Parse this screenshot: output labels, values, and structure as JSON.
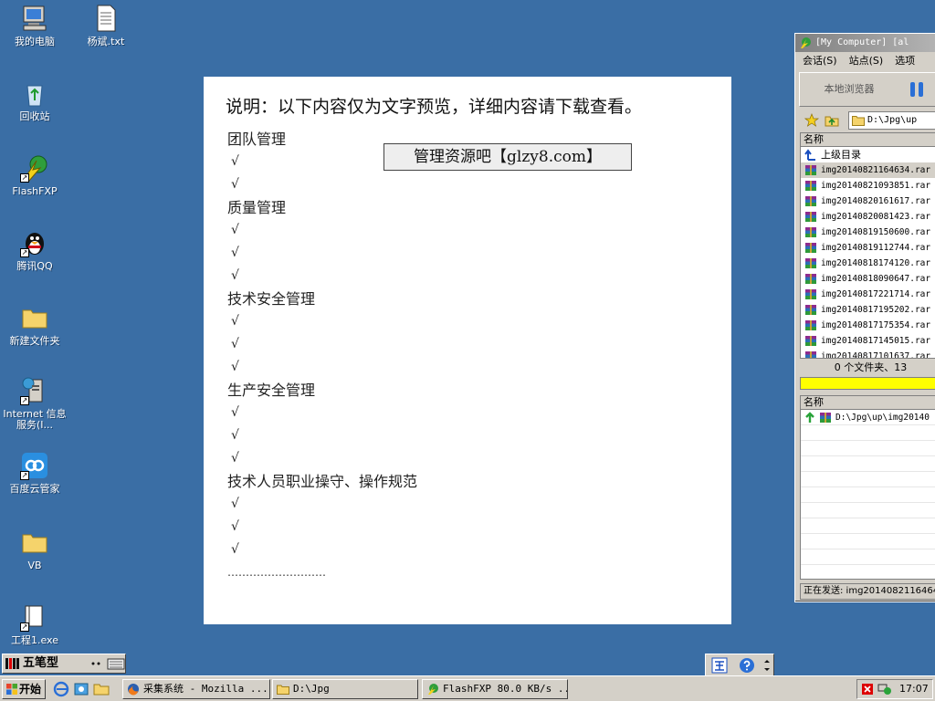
{
  "desktop": {
    "icons": [
      {
        "label": "我的电脑",
        "icon": "my-computer-icon"
      },
      {
        "label": "杨斌.txt",
        "icon": "text-file-icon"
      },
      {
        "label": "回收站",
        "icon": "recycle-bin-icon"
      },
      {
        "label": "FlashFXP",
        "icon": "flashfxp-icon"
      },
      {
        "label": "腾讯QQ",
        "icon": "qq-penguin-icon"
      },
      {
        "label": "新建文件夹",
        "icon": "folder-icon"
      },
      {
        "label": "Internet 信息服务(I...",
        "icon": "iis-icon"
      },
      {
        "label": "百度云管家",
        "icon": "baidu-cloud-icon"
      },
      {
        "label": "VB",
        "icon": "folder-icon"
      },
      {
        "label": "工程1.exe",
        "icon": "exe-icon"
      }
    ]
  },
  "preview": {
    "heading": "说明：以下内容仅为文字预览，详细内容请下载查看。",
    "watermark": "管理资源吧【glzy8.com】",
    "check": "√",
    "sections": [
      {
        "title": "团队管理"
      },
      {
        "title": "质量管理"
      },
      {
        "title": "技术安全管理"
      },
      {
        "title": "生产安全管理"
      },
      {
        "title": "技术人员职业操守、操作规范"
      }
    ],
    "ellipsis": "………………………"
  },
  "flashfxp": {
    "title": "[My Computer]  [al",
    "menu": [
      "会话(S)",
      "站点(S)",
      "选项"
    ],
    "local_browser": "本地浏览器",
    "path": "D:\\Jpg\\up",
    "list_header": "名称",
    "parent_dir": "上级目录",
    "files": [
      "img20140821164634.rar",
      "img20140821093851.rar",
      "img20140820161617.rar",
      "img20140820081423.rar",
      "img20140819150600.rar",
      "img20140819112744.rar",
      "img20140818174120.rar",
      "img20140818090647.rar",
      "img20140817221714.rar",
      "img20140817195202.rar",
      "img20140817175354.rar",
      "img20140817145015.rar",
      "img20140817101637.rar"
    ],
    "status_files": "0 个文件夹、13",
    "queue_header": "名称",
    "queue_item": "D:\\Jpg\\up\\img20140",
    "sending_status": "正在发送: img2014082116464"
  },
  "ime": {
    "label": "五笔型"
  },
  "taskbar": {
    "start_label": "开始",
    "tasks": [
      {
        "label": "采集系统 - Mozilla ..."
      },
      {
        "label": "D:\\Jpg"
      },
      {
        "label": "FlashFXP 80.0 KB/s ..."
      }
    ],
    "clock": "17:07"
  },
  "colors": {
    "desktop": "#3a6ea5",
    "progress": "#ffff00",
    "chrome": "#d4d0c8"
  }
}
